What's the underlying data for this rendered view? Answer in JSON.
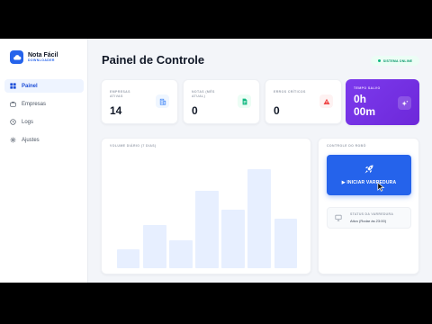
{
  "brand": {
    "name": "Nota Fácil",
    "subtitle": "DOWNLOADER"
  },
  "nav": [
    {
      "label": "Painel",
      "icon": "grid-icon",
      "active": true
    },
    {
      "label": "Empresas",
      "icon": "briefcase-icon"
    },
    {
      "label": "Logs",
      "icon": "history-icon"
    },
    {
      "label": "Ajustes",
      "icon": "gear-icon"
    }
  ],
  "header": {
    "title": "Painel de Controle",
    "status": "SISTEMA ONLINE"
  },
  "stats": [
    {
      "label": "EMPRESAS ATIVAS",
      "value": "14",
      "icon": "building-icon",
      "color": "#3b82f6"
    },
    {
      "label": "NOTAS (MÊS ATUAL)",
      "value": "0",
      "icon": "document-icon",
      "color": "#10b981"
    },
    {
      "label": "ERROS CRÍTICOS",
      "value": "0",
      "icon": "warning-icon",
      "color": "#ef4444"
    }
  ],
  "time_saved": {
    "label": "TEMPO SALVO",
    "line1": "0h",
    "line2": "00m",
    "icon": "sparkle-icon"
  },
  "chart": {
    "title": "VOLUME DIÁRIO (7 DIAS)"
  },
  "chart_data": {
    "type": "bar",
    "title": "VOLUME DIÁRIO (7 DIAS)",
    "categories": [],
    "values": [
      3,
      7,
      4.5,
      12.5,
      9.5,
      16,
      8
    ],
    "ylim": [
      0,
      18
    ],
    "grid": false,
    "color": "#e7efff"
  },
  "control": {
    "title": "CONTROLE DO ROBÔ",
    "button_label": "▶ INICIAR VARREDURA",
    "status_title": "STATUS DA VARREDURA",
    "status_text": "Ativo (Rodar às 23:00)"
  }
}
